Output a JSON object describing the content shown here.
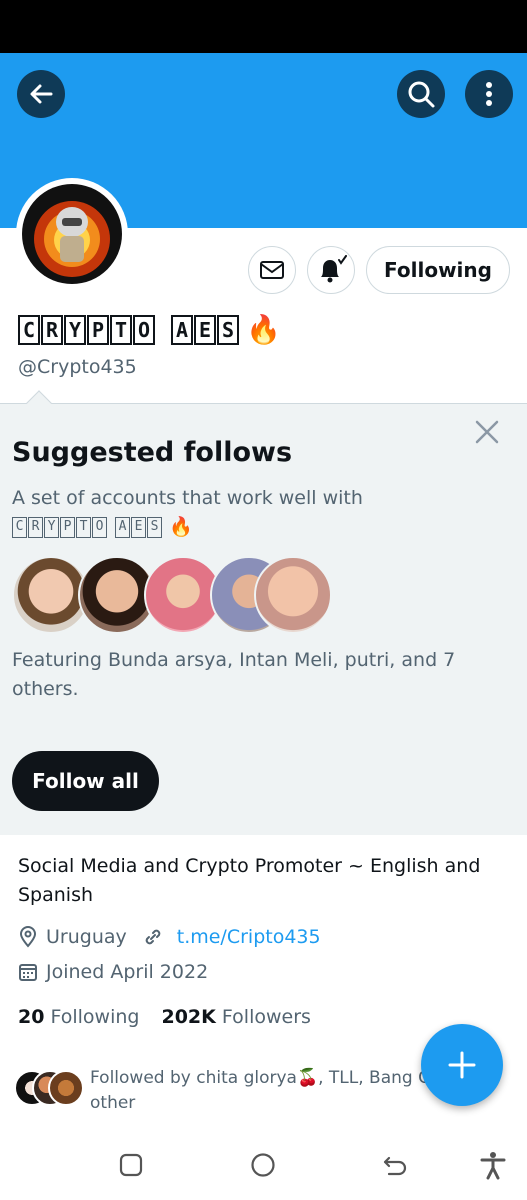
{
  "profile": {
    "display_name_letters": [
      "C",
      "R",
      "Y",
      "P",
      "T",
      "O",
      " ",
      "A",
      "E",
      "S"
    ],
    "display_name_emoji": "🔥",
    "handle": "@Crypto435",
    "following_button_label": "Following"
  },
  "suggested": {
    "title": "Suggested follows",
    "subtitle_prefix": "A set of accounts that work well with ",
    "subtitle_name_letters": [
      "C",
      "R",
      "Y",
      "P",
      "T",
      "O",
      " ",
      "A",
      "E",
      "S"
    ],
    "subtitle_emoji": "🔥",
    "featuring_text": "Featuring Bunda arsya, Intan Meli, putri, and 7 others.",
    "follow_all_label": "Follow all"
  },
  "bio": {
    "text": "Social Media and Crypto Promoter ~ English and Spanish",
    "location": "Uruguay",
    "link": "t.me/Cripto435",
    "joined": "Joined April 2022"
  },
  "stats": {
    "following_count": "20",
    "following_label": "Following",
    "followers_count": "202K",
    "followers_label": "Followers"
  },
  "followed_by": {
    "text": "Followed by chita glorya🍒, TLL, Bang C… 1 other"
  },
  "icons": {
    "back": "back-arrow-icon",
    "search": "search-icon",
    "more": "more-vertical-icon",
    "message": "mail-icon",
    "notifications": "bell-check-icon",
    "close": "close-icon",
    "location": "location-pin-icon",
    "link": "link-icon",
    "calendar": "calendar-icon",
    "compose": "plus-icon"
  },
  "colors": {
    "accent": "#1d9bf0",
    "banner": "#1d9bf0",
    "text_primary": "#0f1419",
    "text_secondary": "#536471",
    "suggest_bg": "#eff3f4"
  }
}
